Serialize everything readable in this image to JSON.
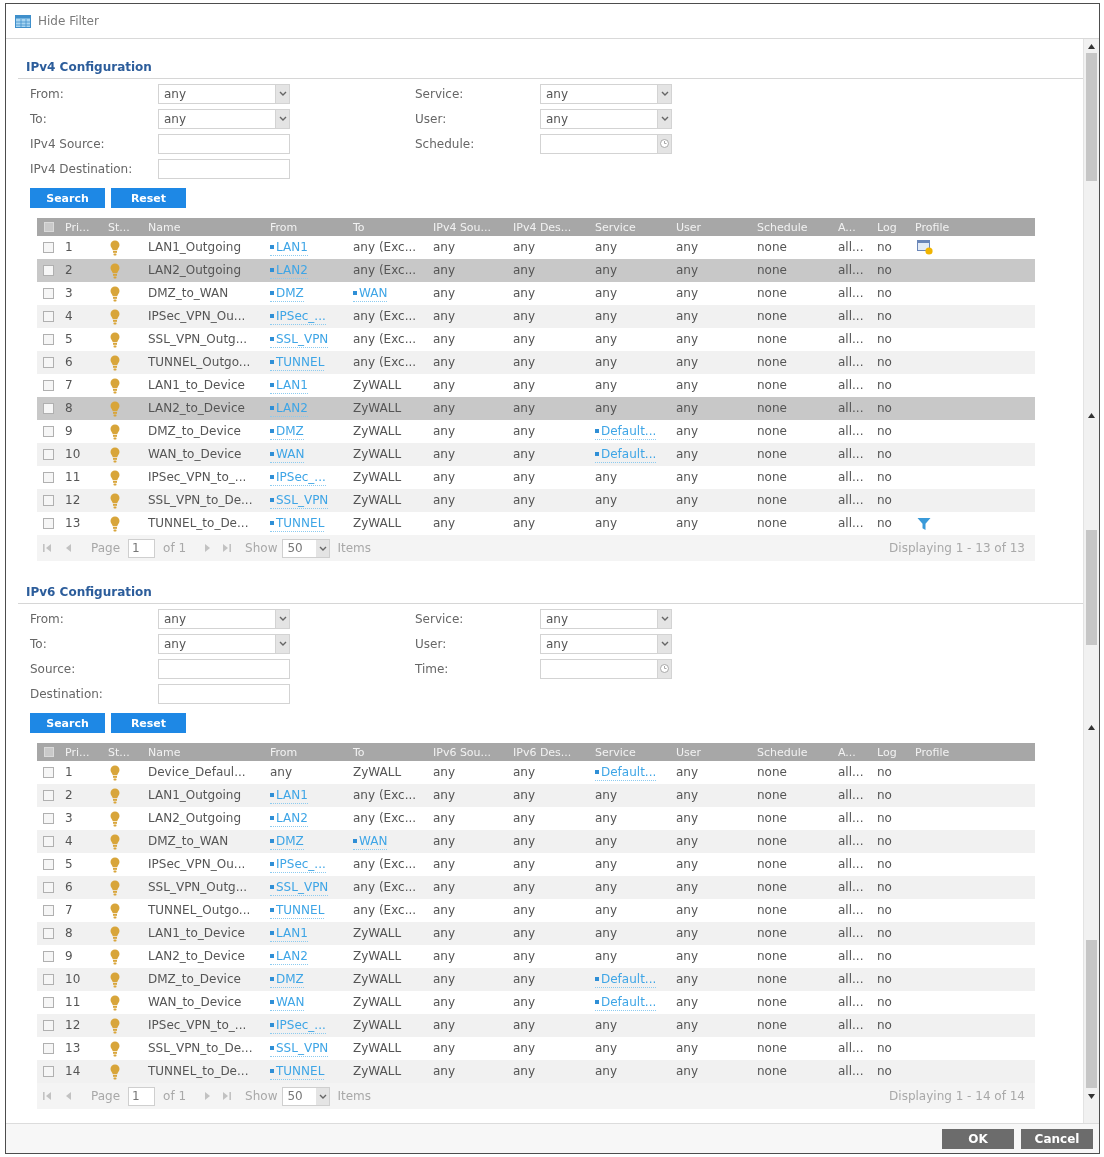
{
  "toolbar": {
    "label": "Hide Filter"
  },
  "sections": [
    {
      "title": "IPv4 Configuration",
      "filters": [
        {
          "label": "From:",
          "kind": "select",
          "value": "any"
        },
        {
          "label": "Service:",
          "kind": "select",
          "value": "any"
        },
        {
          "label": "To:",
          "kind": "select",
          "value": "any"
        },
        {
          "label": "User:",
          "kind": "select",
          "value": "any"
        },
        {
          "label": "IPv4 Source:",
          "kind": "text"
        },
        {
          "label": "Schedule:",
          "kind": "time"
        },
        {
          "label": "IPv4 Destination:",
          "kind": "text"
        }
      ],
      "buttons": [
        "Search",
        "Reset"
      ],
      "table": {
        "all_checked": false,
        "columns": [
          "Pri...",
          "St...",
          "Name",
          "From",
          "To",
          "IPv4 Sou...",
          "IPv4 Des...",
          "Service",
          "User",
          "Schedule",
          "A...",
          "Log",
          "Profile"
        ],
        "rows": [
          {
            "checked": false,
            "selected": false,
            "priority": "1",
            "enabled": true,
            "name": "LAN1_Outgoing",
            "from": {
              "text": "LAN1",
              "link": true
            },
            "to": {
              "text": "any (Exc...",
              "link": false
            },
            "source": "any",
            "destination": "any",
            "service": {
              "text": "any",
              "link": false
            },
            "user": "any",
            "schedule": "none",
            "action": "all...",
            "log": "no",
            "profile": {
              "kind": "card"
            }
          },
          {
            "checked": false,
            "selected": true,
            "priority": "2",
            "enabled": true,
            "name": "LAN2_Outgoing",
            "from": {
              "text": "LAN2",
              "link": true
            },
            "to": {
              "text": "any (Exc...",
              "link": false
            },
            "source": "any",
            "destination": "any",
            "service": {
              "text": "any",
              "link": false
            },
            "user": "any",
            "schedule": "none",
            "action": "all...",
            "log": "no"
          },
          {
            "checked": false,
            "selected": false,
            "priority": "3",
            "enabled": true,
            "name": "DMZ_to_WAN",
            "from": {
              "text": "DMZ",
              "link": true
            },
            "to": {
              "text": "WAN",
              "link": true
            },
            "source": "any",
            "destination": "any",
            "service": {
              "text": "any",
              "link": false
            },
            "user": "any",
            "schedule": "none",
            "action": "all...",
            "log": "no"
          },
          {
            "checked": false,
            "selected": false,
            "priority": "4",
            "enabled": true,
            "name": "IPSec_VPN_Ou...",
            "from": {
              "text": "IPSec_...",
              "link": true
            },
            "to": {
              "text": "any (Exc...",
              "link": false
            },
            "source": "any",
            "destination": "any",
            "service": {
              "text": "any",
              "link": false
            },
            "user": "any",
            "schedule": "none",
            "action": "all...",
            "log": "no"
          },
          {
            "checked": false,
            "selected": false,
            "priority": "5",
            "enabled": true,
            "name": "SSL_VPN_Outg...",
            "from": {
              "text": "SSL_VPN",
              "link": true
            },
            "to": {
              "text": "any (Exc...",
              "link": false
            },
            "source": "any",
            "destination": "any",
            "service": {
              "text": "any",
              "link": false
            },
            "user": "any",
            "schedule": "none",
            "action": "all...",
            "log": "no"
          },
          {
            "checked": false,
            "selected": false,
            "priority": "6",
            "enabled": true,
            "name": "TUNNEL_Outgo...",
            "from": {
              "text": "TUNNEL",
              "link": true
            },
            "to": {
              "text": "any (Exc...",
              "link": false
            },
            "source": "any",
            "destination": "any",
            "service": {
              "text": "any",
              "link": false
            },
            "user": "any",
            "schedule": "none",
            "action": "all...",
            "log": "no"
          },
          {
            "checked": false,
            "selected": false,
            "priority": "7",
            "enabled": true,
            "name": "LAN1_to_Device",
            "from": {
              "text": "LAN1",
              "link": true
            },
            "to": {
              "text": "ZyWALL",
              "link": false
            },
            "source": "any",
            "destination": "any",
            "service": {
              "text": "any",
              "link": false
            },
            "user": "any",
            "schedule": "none",
            "action": "all...",
            "log": "no"
          },
          {
            "checked": false,
            "selected": true,
            "priority": "8",
            "enabled": true,
            "name": "LAN2_to_Device",
            "from": {
              "text": "LAN2",
              "link": true
            },
            "to": {
              "text": "ZyWALL",
              "link": false
            },
            "source": "any",
            "destination": "any",
            "service": {
              "text": "any",
              "link": false
            },
            "user": "any",
            "schedule": "none",
            "action": "all...",
            "log": "no"
          },
          {
            "checked": false,
            "selected": false,
            "priority": "9",
            "enabled": true,
            "name": "DMZ_to_Device",
            "from": {
              "text": "DMZ",
              "link": true
            },
            "to": {
              "text": "ZyWALL",
              "link": false
            },
            "source": "any",
            "destination": "any",
            "service": {
              "text": "Default...",
              "link": true
            },
            "user": "any",
            "schedule": "none",
            "action": "all...",
            "log": "no"
          },
          {
            "checked": false,
            "selected": false,
            "priority": "10",
            "enabled": true,
            "name": "WAN_to_Device",
            "from": {
              "text": "WAN",
              "link": true
            },
            "to": {
              "text": "ZyWALL",
              "link": false
            },
            "source": "any",
            "destination": "any",
            "service": {
              "text": "Default...",
              "link": true
            },
            "user": "any",
            "schedule": "none",
            "action": "all...",
            "log": "no"
          },
          {
            "checked": false,
            "selected": false,
            "priority": "11",
            "enabled": true,
            "name": "IPSec_VPN_to_...",
            "from": {
              "text": "IPSec_...",
              "link": true
            },
            "to": {
              "text": "ZyWALL",
              "link": false
            },
            "source": "any",
            "destination": "any",
            "service": {
              "text": "any",
              "link": false
            },
            "user": "any",
            "schedule": "none",
            "action": "all...",
            "log": "no"
          },
          {
            "checked": false,
            "selected": false,
            "priority": "12",
            "enabled": true,
            "name": "SSL_VPN_to_De...",
            "from": {
              "text": "SSL_VPN",
              "link": true
            },
            "to": {
              "text": "ZyWALL",
              "link": false
            },
            "source": "any",
            "destination": "any",
            "service": {
              "text": "any",
              "link": false
            },
            "user": "any",
            "schedule": "none",
            "action": "all...",
            "log": "no"
          },
          {
            "checked": false,
            "selected": false,
            "priority": "13",
            "enabled": true,
            "name": "TUNNEL_to_De...",
            "from": {
              "text": "TUNNEL",
              "link": true
            },
            "to": {
              "text": "ZyWALL",
              "link": false
            },
            "source": "any",
            "destination": "any",
            "service": {
              "text": "any",
              "link": false
            },
            "user": "any",
            "schedule": "none",
            "action": "all...",
            "log": "no",
            "profile": {
              "kind": "filter"
            }
          }
        ],
        "paging": {
          "page_label": "Page",
          "page": "1",
          "of": "of 1",
          "show_label": "Show",
          "per_page": "50",
          "items_label": "Items",
          "summary": "Displaying 1 - 13 of 13"
        }
      }
    },
    {
      "title": "IPv6 Configuration",
      "filters": [
        {
          "label": "From:",
          "kind": "select",
          "value": "any"
        },
        {
          "label": "Service:",
          "kind": "select",
          "value": "any"
        },
        {
          "label": "To:",
          "kind": "select",
          "value": "any"
        },
        {
          "label": "User:",
          "kind": "select",
          "value": "any"
        },
        {
          "label": "Source:",
          "kind": "text"
        },
        {
          "label": "Time:",
          "kind": "time"
        },
        {
          "label": "Destination:",
          "kind": "text"
        }
      ],
      "buttons": [
        "Search",
        "Reset"
      ],
      "table": {
        "all_checked": false,
        "columns": [
          "Pri...",
          "St...",
          "Name",
          "From",
          "To",
          "IPv6 Sou...",
          "IPv6 Des...",
          "Service",
          "User",
          "Schedule",
          "A...",
          "Log",
          "Profile"
        ],
        "rows": [
          {
            "checked": false,
            "selected": false,
            "priority": "1",
            "enabled": true,
            "name": "Device_Defaul...",
            "from": {
              "text": "any",
              "link": false
            },
            "to": {
              "text": "ZyWALL",
              "link": false
            },
            "source": "any",
            "destination": "any",
            "service": {
              "text": "Default...",
              "link": true
            },
            "user": "any",
            "schedule": "none",
            "action": "all...",
            "log": "no"
          },
          {
            "checked": false,
            "selected": false,
            "priority": "2",
            "enabled": true,
            "name": "LAN1_Outgoing",
            "from": {
              "text": "LAN1",
              "link": true
            },
            "to": {
              "text": "any (Exc...",
              "link": false
            },
            "source": "any",
            "destination": "any",
            "service": {
              "text": "any",
              "link": false
            },
            "user": "any",
            "schedule": "none",
            "action": "all...",
            "log": "no"
          },
          {
            "checked": false,
            "selected": false,
            "priority": "3",
            "enabled": true,
            "name": "LAN2_Outgoing",
            "from": {
              "text": "LAN2",
              "link": true
            },
            "to": {
              "text": "any (Exc...",
              "link": false
            },
            "source": "any",
            "destination": "any",
            "service": {
              "text": "any",
              "link": false
            },
            "user": "any",
            "schedule": "none",
            "action": "all...",
            "log": "no"
          },
          {
            "checked": false,
            "selected": false,
            "priority": "4",
            "enabled": true,
            "name": "DMZ_to_WAN",
            "from": {
              "text": "DMZ",
              "link": true
            },
            "to": {
              "text": "WAN",
              "link": true
            },
            "source": "any",
            "destination": "any",
            "service": {
              "text": "any",
              "link": false
            },
            "user": "any",
            "schedule": "none",
            "action": "all...",
            "log": "no"
          },
          {
            "checked": false,
            "selected": false,
            "priority": "5",
            "enabled": true,
            "name": "IPSec_VPN_Ou...",
            "from": {
              "text": "IPSec_...",
              "link": true
            },
            "to": {
              "text": "any (Exc...",
              "link": false
            },
            "source": "any",
            "destination": "any",
            "service": {
              "text": "any",
              "link": false
            },
            "user": "any",
            "schedule": "none",
            "action": "all...",
            "log": "no"
          },
          {
            "checked": false,
            "selected": false,
            "priority": "6",
            "enabled": true,
            "name": "SSL_VPN_Outg...",
            "from": {
              "text": "SSL_VPN",
              "link": true
            },
            "to": {
              "text": "any (Exc...",
              "link": false
            },
            "source": "any",
            "destination": "any",
            "service": {
              "text": "any",
              "link": false
            },
            "user": "any",
            "schedule": "none",
            "action": "all...",
            "log": "no"
          },
          {
            "checked": false,
            "selected": false,
            "priority": "7",
            "enabled": true,
            "name": "TUNNEL_Outgo...",
            "from": {
              "text": "TUNNEL",
              "link": true
            },
            "to": {
              "text": "any (Exc...",
              "link": false
            },
            "source": "any",
            "destination": "any",
            "service": {
              "text": "any",
              "link": false
            },
            "user": "any",
            "schedule": "none",
            "action": "all...",
            "log": "no"
          },
          {
            "checked": false,
            "selected": false,
            "priority": "8",
            "enabled": true,
            "name": "LAN1_to_Device",
            "from": {
              "text": "LAN1",
              "link": true
            },
            "to": {
              "text": "ZyWALL",
              "link": false
            },
            "source": "any",
            "destination": "any",
            "service": {
              "text": "any",
              "link": false
            },
            "user": "any",
            "schedule": "none",
            "action": "all...",
            "log": "no"
          },
          {
            "checked": false,
            "selected": false,
            "priority": "9",
            "enabled": true,
            "name": "LAN2_to_Device",
            "from": {
              "text": "LAN2",
              "link": true
            },
            "to": {
              "text": "ZyWALL",
              "link": false
            },
            "source": "any",
            "destination": "any",
            "service": {
              "text": "any",
              "link": false
            },
            "user": "any",
            "schedule": "none",
            "action": "all...",
            "log": "no"
          },
          {
            "checked": false,
            "selected": false,
            "priority": "10",
            "enabled": true,
            "name": "DMZ_to_Device",
            "from": {
              "text": "DMZ",
              "link": true
            },
            "to": {
              "text": "ZyWALL",
              "link": false
            },
            "source": "any",
            "destination": "any",
            "service": {
              "text": "Default...",
              "link": true
            },
            "user": "any",
            "schedule": "none",
            "action": "all...",
            "log": "no"
          },
          {
            "checked": false,
            "selected": false,
            "priority": "11",
            "enabled": true,
            "name": "WAN_to_Device",
            "from": {
              "text": "WAN",
              "link": true
            },
            "to": {
              "text": "ZyWALL",
              "link": false
            },
            "source": "any",
            "destination": "any",
            "service": {
              "text": "Default...",
              "link": true
            },
            "user": "any",
            "schedule": "none",
            "action": "all...",
            "log": "no"
          },
          {
            "checked": false,
            "selected": false,
            "priority": "12",
            "enabled": true,
            "name": "IPSec_VPN_to_...",
            "from": {
              "text": "IPSec_...",
              "link": true
            },
            "to": {
              "text": "ZyWALL",
              "link": false
            },
            "source": "any",
            "destination": "any",
            "service": {
              "text": "any",
              "link": false
            },
            "user": "any",
            "schedule": "none",
            "action": "all...",
            "log": "no"
          },
          {
            "checked": false,
            "selected": false,
            "priority": "13",
            "enabled": true,
            "name": "SSL_VPN_to_De...",
            "from": {
              "text": "SSL_VPN",
              "link": true
            },
            "to": {
              "text": "ZyWALL",
              "link": false
            },
            "source": "any",
            "destination": "any",
            "service": {
              "text": "any",
              "link": false
            },
            "user": "any",
            "schedule": "none",
            "action": "all...",
            "log": "no"
          },
          {
            "checked": false,
            "selected": false,
            "priority": "14",
            "enabled": true,
            "name": "TUNNEL_to_De...",
            "from": {
              "text": "TUNNEL",
              "link": true
            },
            "to": {
              "text": "ZyWALL",
              "link": false
            },
            "source": "any",
            "destination": "any",
            "service": {
              "text": "any",
              "link": false
            },
            "user": "any",
            "schedule": "none",
            "action": "all...",
            "log": "no"
          }
        ],
        "paging": {
          "page_label": "Page",
          "page": "1",
          "of": "of 1",
          "show_label": "Show",
          "per_page": "50",
          "items_label": "Items",
          "summary": "Displaying 1 - 14 of 14"
        }
      }
    }
  ],
  "dialog_buttons": [
    "OK",
    "Cancel"
  ]
}
